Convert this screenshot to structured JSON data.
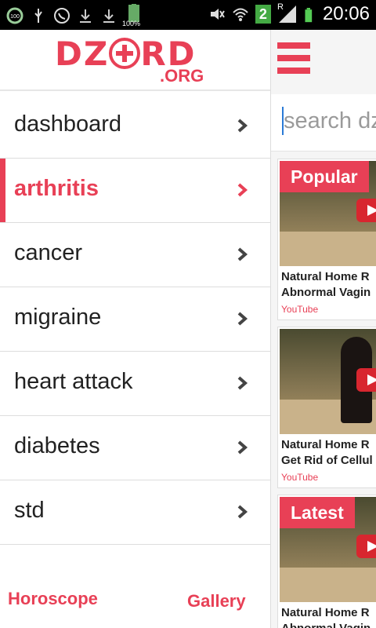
{
  "status_bar": {
    "time": "20:06",
    "battery_label": "100%",
    "signal_badge": "2",
    "roaming": "R",
    "left_icons": [
      "battery-saver-icon",
      "usb-icon",
      "whatsapp-icon",
      "download-icon",
      "download-icon",
      "battery-icon"
    ],
    "right_icons": [
      "mute-icon",
      "wifi-icon",
      "sim-2-icon",
      "signal-icon",
      "battery-icon"
    ]
  },
  "logo": {
    "main": "DZ",
    "main_end": "RD",
    "suffix": ".ORG"
  },
  "menu": [
    {
      "label": "dashboard",
      "active": false
    },
    {
      "label": "arthritis",
      "active": true
    },
    {
      "label": "cancer",
      "active": false
    },
    {
      "label": "migraine",
      "active": false
    },
    {
      "label": "heart attack",
      "active": false
    },
    {
      "label": "diabetes",
      "active": false
    },
    {
      "label": "std",
      "active": false
    }
  ],
  "footer": {
    "left": "Horoscope",
    "right": "Gallery"
  },
  "search": {
    "placeholder": "search dz"
  },
  "cards": [
    {
      "badge": "Popular",
      "title_line1": "Natural Home R",
      "title_line2": "Abnormal Vagin",
      "source": "YouTube"
    },
    {
      "badge": "",
      "title_line1": "Natural Home R",
      "title_line2": "Get Rid of Cellul",
      "source": "YouTube"
    },
    {
      "badge": "Latest",
      "title_line1": "Natural Home R",
      "title_line2": "Abnormal Vagin",
      "source": ""
    }
  ],
  "colors": {
    "accent": "#e84056",
    "status_bar": "#000000"
  }
}
